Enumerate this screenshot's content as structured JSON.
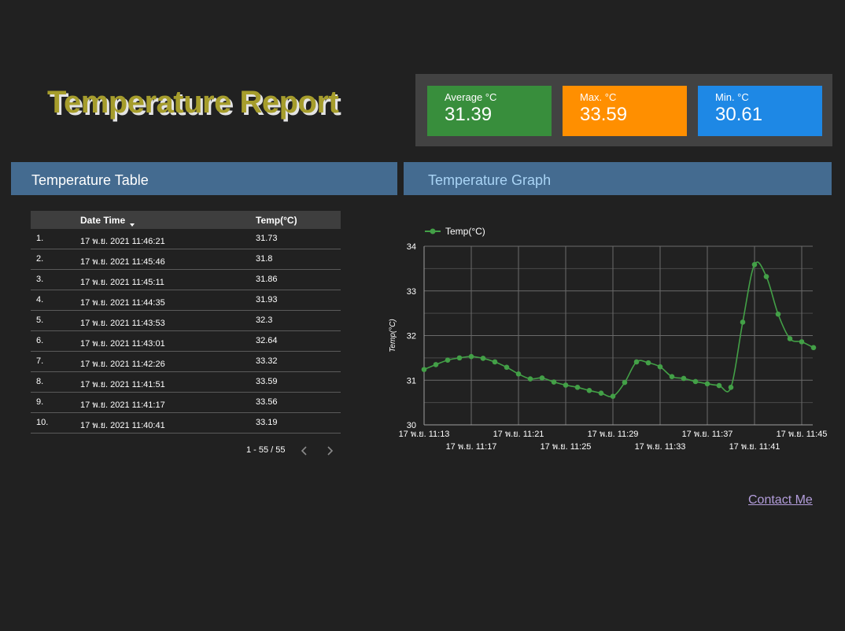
{
  "title": "Temperature Report",
  "kpis": {
    "average": {
      "label": "Average °C",
      "value": "31.39",
      "color": "#388e3c"
    },
    "max": {
      "label": "Max. °C",
      "value": "33.59",
      "color": "#ff8f00"
    },
    "min": {
      "label": "Min. °C",
      "value": "30.61",
      "color": "#1e88e5"
    }
  },
  "table_section": {
    "title": "Temperature Table",
    "columns": [
      "",
      "Date Time",
      "Temp(°C)"
    ],
    "rows": [
      {
        "idx": "1.",
        "date": "17 พ.ย. 2021 11:46:21",
        "temp": "31.73"
      },
      {
        "idx": "2.",
        "date": "17 พ.ย. 2021 11:45:46",
        "temp": "31.8"
      },
      {
        "idx": "3.",
        "date": "17 พ.ย. 2021 11:45:11",
        "temp": "31.86"
      },
      {
        "idx": "4.",
        "date": "17 พ.ย. 2021 11:44:35",
        "temp": "31.93"
      },
      {
        "idx": "5.",
        "date": "17 พ.ย. 2021 11:43:53",
        "temp": "32.3"
      },
      {
        "idx": "6.",
        "date": "17 พ.ย. 2021 11:43:01",
        "temp": "32.64"
      },
      {
        "idx": "7.",
        "date": "17 พ.ย. 2021 11:42:26",
        "temp": "33.32"
      },
      {
        "idx": "8.",
        "date": "17 พ.ย. 2021 11:41:51",
        "temp": "33.59"
      },
      {
        "idx": "9.",
        "date": "17 พ.ย. 2021 11:41:17",
        "temp": "33.56"
      },
      {
        "idx": "10.",
        "date": "17 พ.ย. 2021 11:40:41",
        "temp": "33.19"
      }
    ],
    "pagination": "1 - 55 / 55"
  },
  "graph_section": {
    "title": "Temperature Graph"
  },
  "chart_data": {
    "type": "line",
    "title": "",
    "xlabel": "",
    "ylabel": "Temp(°C)",
    "ylim": [
      30,
      34
    ],
    "yticks": [
      "30",
      "31",
      "32",
      "33",
      "34"
    ],
    "xticks": [
      "17 พ.ย. 11:13",
      "17 พ.ย. 11:17",
      "17 พ.ย. 11:21",
      "17 พ.ย. 11:25",
      "17 พ.ย. 11:29",
      "17 พ.ย. 11:33",
      "17 พ.ย. 11:37",
      "17 พ.ย. 11:41",
      "17 พ.ย. 11:45"
    ],
    "grid": true,
    "legend": "top-left",
    "series": [
      {
        "name": "Temp(°C)",
        "color": "#43a047",
        "x_minutes_after_11_13": [
          0,
          1,
          2,
          3,
          4,
          5,
          6,
          7,
          8,
          9,
          10,
          11,
          12,
          13,
          14,
          15,
          16,
          17,
          18,
          19,
          20,
          21,
          22,
          23,
          24,
          25,
          26,
          27,
          28,
          29,
          30,
          31,
          32,
          33
        ],
        "values": [
          31.24,
          31.35,
          31.45,
          31.5,
          31.53,
          31.49,
          31.41,
          31.29,
          31.14,
          31.03,
          31.05,
          30.96,
          30.89,
          30.84,
          30.77,
          30.71,
          30.64,
          30.95,
          31.41,
          31.39,
          31.3,
          31.08,
          31.04,
          30.97,
          30.92,
          30.88,
          30.84,
          32.3,
          33.59,
          33.32,
          32.48,
          31.93,
          31.86,
          31.73
        ]
      }
    ]
  },
  "contact_link": "Contact Me"
}
